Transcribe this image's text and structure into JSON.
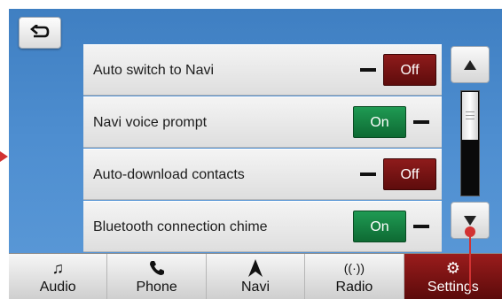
{
  "back_button": {
    "icon": "back-arrow-icon"
  },
  "settings_rows": [
    {
      "label": "Auto switch to Navi",
      "state": "Off"
    },
    {
      "label": "Navi voice prompt",
      "state": "On"
    },
    {
      "label": "Auto-download contacts",
      "state": "Off"
    },
    {
      "label": "Bluetooth connection chime",
      "state": "On"
    }
  ],
  "scroll": {
    "up_icon": "triangle-up-icon",
    "down_icon": "triangle-down-icon"
  },
  "nav": [
    {
      "label": "Audio",
      "icon": "music-note-icon"
    },
    {
      "label": "Phone",
      "icon": "phone-icon"
    },
    {
      "label": "Navi",
      "icon": "navigation-arrow-icon"
    },
    {
      "label": "Radio",
      "icon": "radio-antenna-icon"
    },
    {
      "label": "Settings",
      "icon": "gears-icon",
      "active": true
    }
  ],
  "colors": {
    "background": "#4e8ed0",
    "on": "#1f9a53",
    "off": "#7a1414",
    "active_tab": "#8a1818",
    "pointer": "#d23232"
  }
}
